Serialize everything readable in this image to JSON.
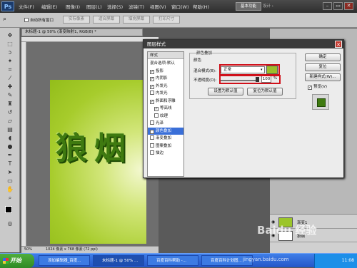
{
  "app": {
    "logo": "Ps",
    "menu": [
      "文件(F)",
      "编辑(E)",
      "图像(I)",
      "图层(L)",
      "选择(S)",
      "滤镜(T)",
      "视图(V)",
      "窗口(W)",
      "帮助(H)"
    ],
    "workspace_label": "基本功能",
    "workspace2": "设计 ›",
    "window_buttons": [
      "–",
      "▭",
      "✕"
    ]
  },
  "options": {
    "checkbox_label": "自动所有窗口",
    "buttons": [
      "实际像素",
      "适合屏幕",
      "填充屏幕",
      "打印尺寸"
    ]
  },
  "document": {
    "tab_title": "未标题-1 @ 50% (渐变映射1, RGB/8) *",
    "zoom": "50%",
    "status": "1024 像素 x 768 像素 (72 ppi)",
    "glyphs": [
      "狼",
      "烟"
    ]
  },
  "dialog": {
    "title": "图层样式",
    "close_glyph": "✕",
    "styles_header": "样式",
    "styles": [
      {
        "label": "混合选项:默认",
        "checkbox": false,
        "checked": false,
        "selected": false
      },
      {
        "label": "投影",
        "checkbox": true,
        "checked": true,
        "selected": false
      },
      {
        "label": "内阴影",
        "checkbox": true,
        "checked": true,
        "selected": false
      },
      {
        "label": "外发光",
        "checkbox": true,
        "checked": true,
        "selected": false
      },
      {
        "label": "内发光",
        "checkbox": true,
        "checked": false,
        "selected": false
      },
      {
        "label": "斜面和浮雕",
        "checkbox": true,
        "checked": true,
        "selected": false
      },
      {
        "label": "等高线",
        "checkbox": true,
        "checked": true,
        "selected": false
      },
      {
        "label": "纹理",
        "checkbox": true,
        "checked": false,
        "selected": false
      },
      {
        "label": "光泽",
        "checkbox": true,
        "checked": false,
        "selected": false
      },
      {
        "label": "颜色叠加",
        "checkbox": true,
        "checked": true,
        "selected": true
      },
      {
        "label": "渐变叠加",
        "checkbox": true,
        "checked": false,
        "selected": false
      },
      {
        "label": "图案叠加",
        "checkbox": true,
        "checked": false,
        "selected": false
      },
      {
        "label": "描边",
        "checkbox": true,
        "checked": false,
        "selected": false
      }
    ],
    "group_title": "颜色叠加",
    "subgroup_title": "颜色",
    "blend_label": "混合模式(B):",
    "blend_value": "正常",
    "opacity_label": "不透明度(O):",
    "opacity_value": "100",
    "opacity_unit": "%",
    "opacity_fraction": 1.0,
    "overlay_color": "#9cbd2a",
    "btn_set_default": "设置为默认值",
    "btn_reset_default": "复位为默认值",
    "btn_ok": "确定",
    "btn_reset": "复位",
    "btn_new_style": "新建样式(W)...",
    "preview_label": "预览(V)"
  },
  "layers": {
    "rows": [
      "渐变1",
      "狼烟"
    ]
  },
  "taskbar": {
    "start": "开始",
    "tasks": [
      "添加编辑器_百度...",
      "未标题-1 @ 50% ...",
      "百度百科帮助 -...",
      "百度百科计划图..."
    ],
    "clock": "11:08"
  },
  "watermark": "jingyan.baidu.com",
  "watermark_brand": "Baidu 经验"
}
